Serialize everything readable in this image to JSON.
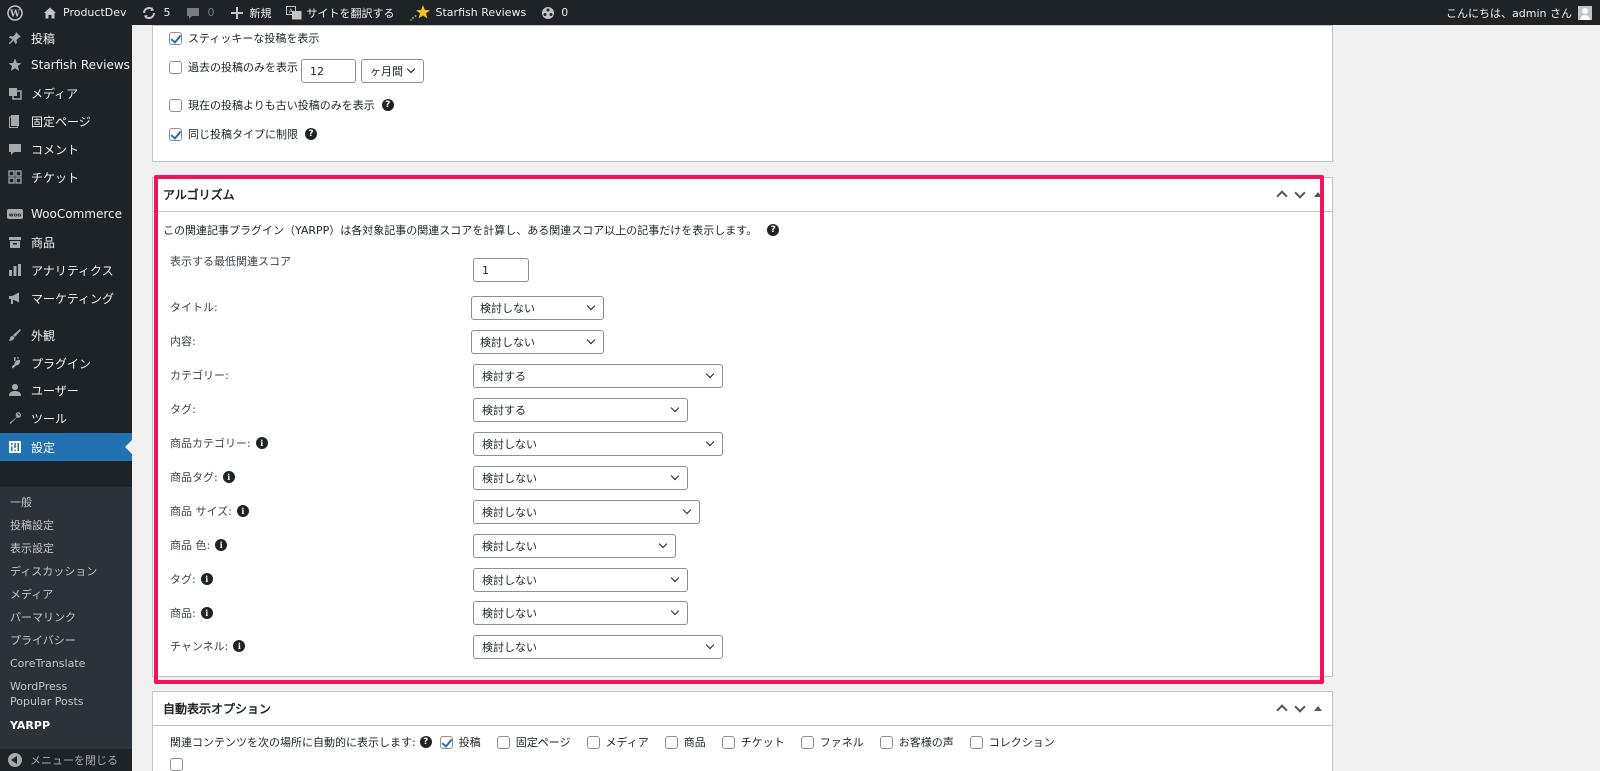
{
  "adminbar": {
    "site_name": "ProductDev",
    "updates_count": "5",
    "comments_count": "0",
    "new_label": "新規",
    "translate_label": "サイトを翻訳する",
    "starfish_label": "Starfish Reviews",
    "extra_count": "0",
    "greeting": "こんにちは、admin さん"
  },
  "sidebar": {
    "items": [
      {
        "label": "投稿",
        "icon": "pin-icon"
      },
      {
        "label": "Starfish Reviews",
        "icon": "star-icon"
      },
      {
        "label": "メディア",
        "icon": "media-icon"
      },
      {
        "label": "固定ページ",
        "icon": "page-icon"
      },
      {
        "label": "コメント",
        "icon": "comment-icon"
      },
      {
        "label": "チケット",
        "icon": "grid-icon"
      },
      {
        "label": "WooCommerce",
        "icon": "woo-icon"
      },
      {
        "label": "商品",
        "icon": "archive-icon"
      },
      {
        "label": "アナリティクス",
        "icon": "chart-icon"
      },
      {
        "label": "マーケティング",
        "icon": "megaphone-icon"
      },
      {
        "label": "外観",
        "icon": "brush-icon"
      },
      {
        "label": "プラグイン",
        "icon": "plugin-icon"
      },
      {
        "label": "ユーザー",
        "icon": "user-icon"
      },
      {
        "label": "ツール",
        "icon": "wrench-icon"
      },
      {
        "label": "設定",
        "icon": "settings-icon"
      }
    ],
    "submenu": [
      "一般",
      "投稿設定",
      "表示設定",
      "ディスカッション",
      "メディア",
      "パーマリンク",
      "プライバシー",
      "CoreTranslate",
      "WordPress Popular Posts",
      "YARPP"
    ],
    "collapse_label": "メニューを閉じる"
  },
  "top_box": {
    "sticky_label": "スティッキーな投稿を表示",
    "past_label": "過去の投稿のみを表示",
    "past_value": "12",
    "past_unit": "ヶ月間",
    "older_label": "現在の投稿よりも古い投稿のみを表示",
    "same_type_label": "同じ投稿タイプに制限"
  },
  "algorithm": {
    "title": "アルゴリズム",
    "description": "この関連記事プラグイン（YARPP）は各対象記事の関連スコアを計算し、ある関連スコア以上の記事だけを表示します。",
    "min_score_label": "表示する最低関連スコア",
    "min_score_value": "1",
    "rows": [
      {
        "label": "タイトル:",
        "value": "検討しない"
      },
      {
        "label": "内容:",
        "value": "検討しない"
      },
      {
        "label": "カテゴリー:",
        "value": "検討する"
      },
      {
        "label": "タグ:",
        "value": "検討する"
      },
      {
        "label": "商品カテゴリー:",
        "value": "検討しない"
      },
      {
        "label": "商品タグ:",
        "value": "検討しない"
      },
      {
        "label": "商品 サイズ:",
        "value": "検討しない"
      },
      {
        "label": "商品 色:",
        "value": "検討しない"
      },
      {
        "label": "タグ:",
        "value": "検討しない"
      },
      {
        "label": "商品:",
        "value": "検討しない"
      },
      {
        "label": "チャンネル:",
        "value": "検討しない"
      }
    ]
  },
  "auto_display": {
    "title": "自動表示オプション",
    "label": "関連コンテンツを次の場所に自動的に表示します:",
    "options": [
      "投稿",
      "固定ページ",
      "メディア",
      "商品",
      "チケット",
      "ファネル",
      "お客様の声",
      "コレクション"
    ]
  },
  "colors": {
    "highlight": "#f0145a",
    "accent": "#2271b1"
  }
}
